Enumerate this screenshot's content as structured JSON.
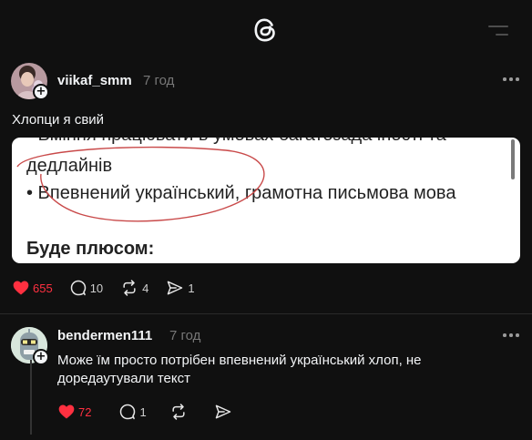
{
  "header": {
    "logo_icon": "threads-logo-icon",
    "menu_icon": "menu-icon"
  },
  "post": {
    "username": "viikaf_smm",
    "time": "7 год",
    "text": "Хлопци я свий",
    "media": {
      "line_top": "• Вміння працювати в умовах багатозадачності та",
      "line_cont": "дедлайнів",
      "line_lang": "• Впевнений український, грамотна письмова мова",
      "line_bonus": "Буде плюсом:"
    },
    "actions": {
      "likes": "655",
      "comments": "10",
      "reposts": "4",
      "shares": "1"
    },
    "accent": "#ff3040"
  },
  "reply": {
    "username": "bendermen111",
    "time": "7 год",
    "text": "Може їм просто потрібен впевнений український хлоп, не доредаутували текст",
    "actions": {
      "likes": "72",
      "comments": "1"
    }
  }
}
